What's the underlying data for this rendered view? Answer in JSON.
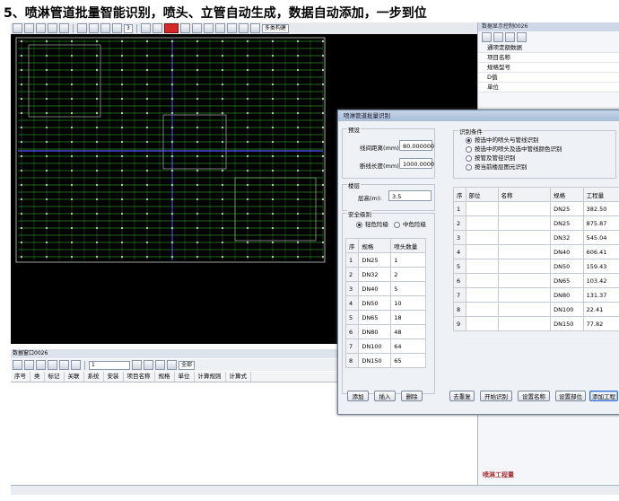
{
  "headline": "5、喷淋管道批量智能识别，喷头、立管自动生成，数据自动添加，一步到位",
  "toolbar": {
    "layer_value": "3",
    "dropdown_label": "多类构建"
  },
  "bottom_panel": {
    "title": "数据窗口0026",
    "filter_value": "1",
    "filter_all": "全部",
    "columns": [
      "序号",
      "类",
      "标记",
      "关联",
      "系统",
      "安装",
      "项目名称",
      "规格",
      "单位",
      "计算规则",
      "计算式"
    ]
  },
  "property_panel": {
    "title": "数据显示控制0026",
    "rows": [
      "通项定额数据",
      "项目名称",
      "规格型号",
      "D值",
      "单位"
    ],
    "logo": "喷淋工程量"
  },
  "dialog": {
    "title": "喷淋管道批量识别",
    "preset_label": "预设",
    "line_distance_label": "线间距离(mm):",
    "line_distance_value": "80.000000",
    "break_length_label": "断线长度(mm):",
    "break_length_value": "1000.0000",
    "layer_group_label": "楼层",
    "floor_height_label": "层高(m):",
    "floor_height_value": "3.5",
    "safety_group_label": "安全级别",
    "safety_options": [
      {
        "label": "轻危险级",
        "selected": true
      },
      {
        "label": "中危险级",
        "selected": false
      }
    ],
    "condition_group_label": "识别条件",
    "conditions": [
      {
        "label": "按选中的喷头与管线识别",
        "selected": true
      },
      {
        "label": "按选中的喷头及选中管线颜色识别",
        "selected": false
      },
      {
        "label": "按管及管径识别",
        "selected": false
      },
      {
        "label": "按当前楼层图元识别",
        "selected": false
      }
    ],
    "spec_table": {
      "headers": [
        "序",
        "规格",
        "喷头数量"
      ],
      "rows": [
        [
          "1",
          "DN25",
          "1"
        ],
        [
          "2",
          "DN32",
          "2"
        ],
        [
          "3",
          "DN40",
          "5"
        ],
        [
          "4",
          "DN50",
          "10"
        ],
        [
          "5",
          "DN65",
          "18"
        ],
        [
          "6",
          "DN80",
          "48"
        ],
        [
          "7",
          "DN100",
          "64"
        ],
        [
          "8",
          "DN150",
          "65"
        ]
      ]
    },
    "result_table": {
      "headers": [
        "序",
        "部位",
        "名称",
        "规格",
        "工程量"
      ],
      "rows": [
        [
          "1",
          "",
          "",
          "DN25",
          "382.50"
        ],
        [
          "2",
          "",
          "",
          "DN25",
          "875.87"
        ],
        [
          "3",
          "",
          "",
          "DN32",
          "545.04"
        ],
        [
          "4",
          "",
          "",
          "DN40",
          "606.41"
        ],
        [
          "5",
          "",
          "",
          "DN50",
          "159.43"
        ],
        [
          "6",
          "",
          "",
          "DN65",
          "103.42"
        ],
        [
          "7",
          "",
          "",
          "DN80",
          "131.37"
        ],
        [
          "8",
          "",
          "",
          "DN100",
          "22.41"
        ],
        [
          "9",
          "",
          "",
          "DN150",
          "77.82"
        ]
      ]
    },
    "buttons": {
      "add": "添加",
      "insert": "插入",
      "delete": "删除",
      "dedupe": "去重复",
      "start": "开始识别",
      "set_name": "设置名称",
      "set_part": "设置部位",
      "add_engineering": "添加工程"
    }
  },
  "colors": {
    "cad_background": "#000000",
    "pipe_green": "#3cd23c",
    "wall_white": "#cfcfcf",
    "accent_blue": "#3a6fd1"
  }
}
